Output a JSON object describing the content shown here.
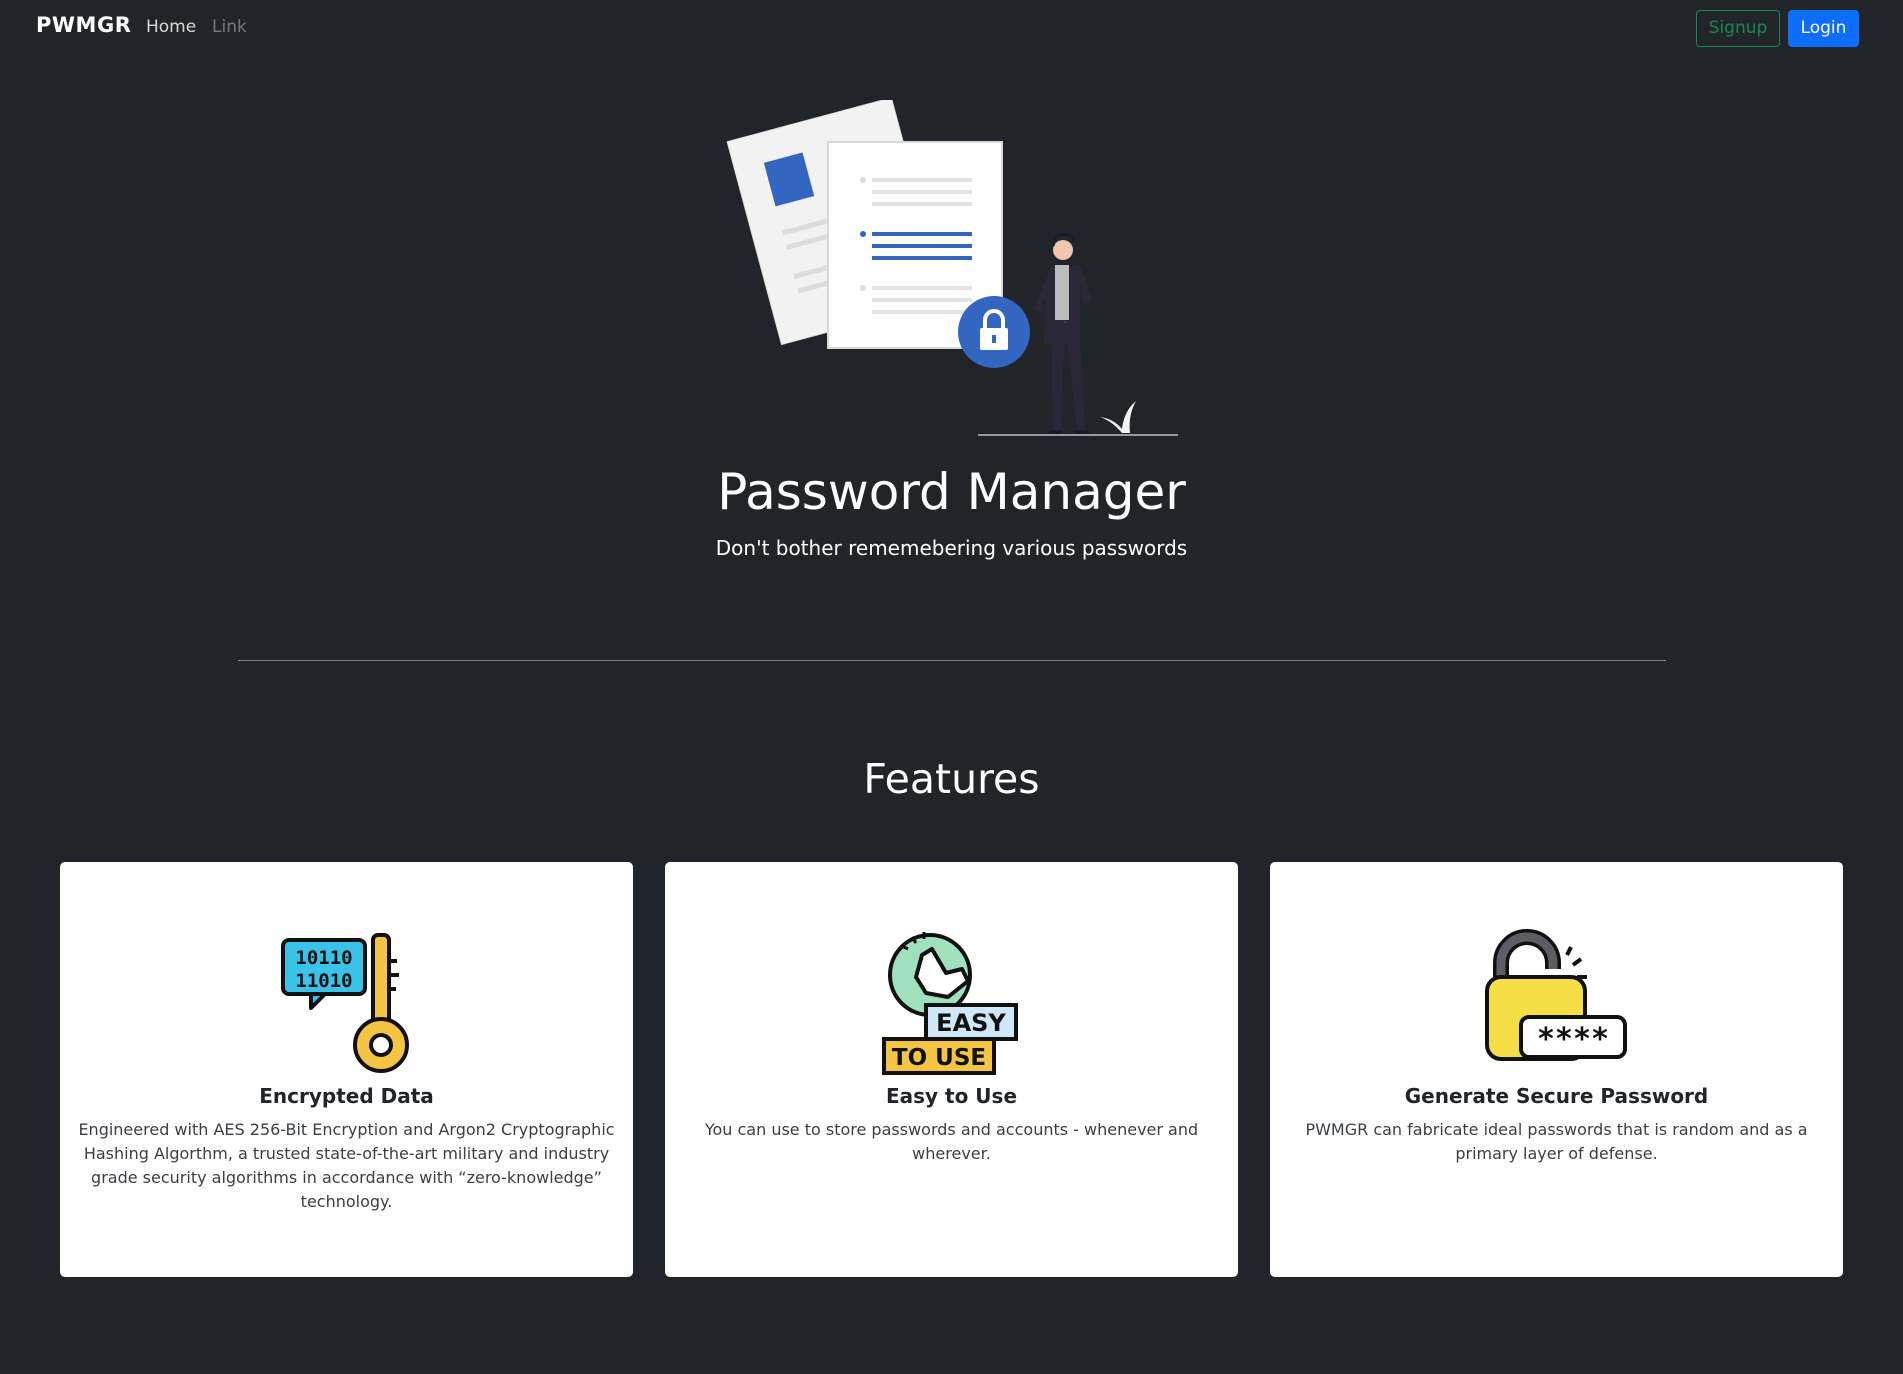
{
  "navbar": {
    "brand": "PWMGR",
    "links": [
      {
        "label": "Home"
      },
      {
        "label": "Link"
      }
    ],
    "signup_label": "Signup",
    "login_label": "Login"
  },
  "hero": {
    "title": "Password Manager",
    "subtitle": "Don't bother rememebering various passwords",
    "illustration_icon": "document-lock-person-illustration"
  },
  "features": {
    "title": "Features",
    "cards": [
      {
        "icon": "binary-key-icon",
        "title": "Encrypted Data",
        "text": "Engineered with AES 256-Bit Encryption and Argon2 Cryptographic Hashing Algorthm, a trusted state-of-the-art military and industry grade security algorithms in accordance with “zero-knowledge” technology.",
        "icon_binary_top": "10110",
        "icon_binary_bottom": "11010"
      },
      {
        "icon": "easy-to-use-icon",
        "title": "Easy to Use",
        "text": "You can use to store passwords and accounts - whenever and wherever.",
        "icon_badge_top": "EASY",
        "icon_badge_bottom": "TO USE"
      },
      {
        "icon": "padlock-password-icon",
        "title": "Generate Secure Password",
        "text": "PWMGR can fabricate ideal passwords that is random and as a primary layer of defense.",
        "icon_mask": "****"
      }
    ]
  },
  "colors": {
    "background": "#212529",
    "signup": "#198754",
    "login": "#0d6efd",
    "accent_blue": "#3366c0"
  }
}
